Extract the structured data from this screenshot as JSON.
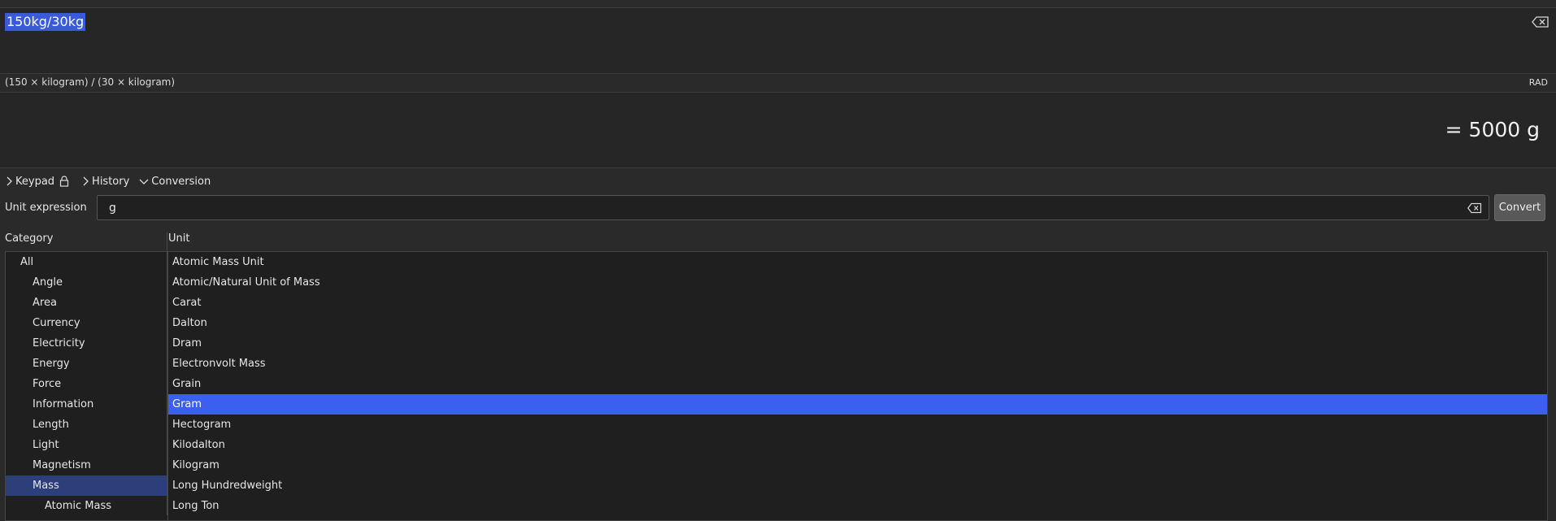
{
  "expression": {
    "text": "150kg/30kg"
  },
  "parsed": {
    "text": "(150 × kilogram) / (30 × kilogram)",
    "angle_mode": "RAD"
  },
  "result": {
    "text": "= 5000 g"
  },
  "toggles": {
    "keypad": "Keypad",
    "history": "History",
    "conversion": "Conversion"
  },
  "conversion": {
    "unit_expression_label": "Unit expression",
    "unit_expression_value": "g",
    "convert_label": "Convert",
    "category_header": "Category",
    "unit_header": "Unit",
    "categories": [
      "All",
      "Angle",
      "Area",
      "Currency",
      "Electricity",
      "Energy",
      "Force",
      "Information",
      "Length",
      "Light",
      "Magnetism",
      "Mass",
      "Atomic Mass"
    ],
    "selected_category": "Mass",
    "units": [
      "Atomic Mass Unit",
      "Atomic/Natural Unit of Mass",
      "Carat",
      "Dalton",
      "Dram",
      "Electronvolt Mass",
      "Grain",
      "Gram",
      "Hectogram",
      "Kilodalton",
      "Kilogram",
      "Long Hundredweight",
      "Long Ton"
    ],
    "selected_unit": "Gram"
  },
  "colors": {
    "selection": "#3c5ff0",
    "background": "#262626"
  }
}
